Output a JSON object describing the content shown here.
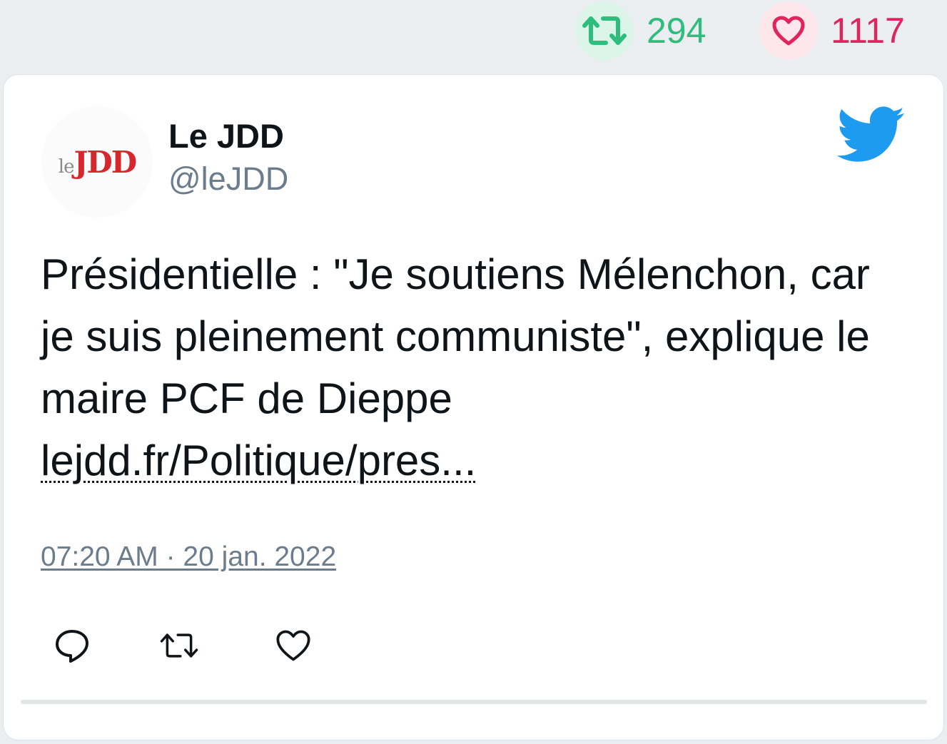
{
  "stats": {
    "retweets": "294",
    "likes": "1117"
  },
  "tweet": {
    "author": {
      "name": "Le JDD",
      "handle": "@leJDD",
      "logo_le": "le",
      "logo_jdd": "JDD"
    },
    "text": "Présidentielle : \"Je soutiens Mélenchon, car je suis pleinement communiste\", explique le maire PCF de Dieppe",
    "link": "lejdd.fr/Politique/pres...",
    "timestamp": "07:20 AM · 20 jan. 2022"
  },
  "icons": {
    "retweet": "retweet-icon",
    "like": "heart-icon",
    "reply": "reply-icon",
    "brand": "twitter-bird-icon"
  },
  "colors": {
    "retweet": "#2ebd7d",
    "like": "#e0245e",
    "twitter": "#1d9bf0",
    "brand_red": "#d8262d"
  }
}
